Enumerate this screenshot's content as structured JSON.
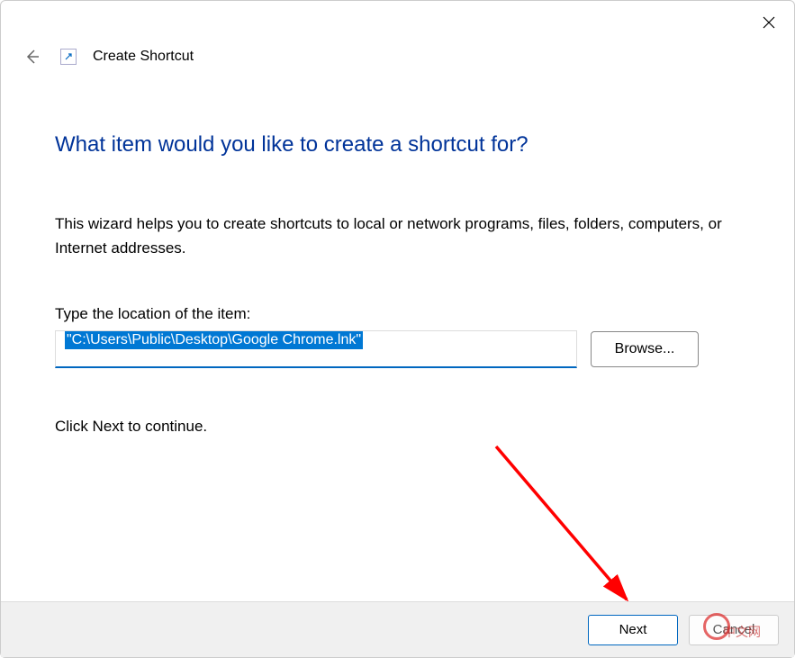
{
  "window": {
    "title": "Create Shortcut"
  },
  "wizard": {
    "heading": "What item would you like to create a shortcut for?",
    "description": "This wizard helps you to create shortcuts to local or network programs, files, folders, computers, or Internet addresses.",
    "location_label": "Type the location of the item:",
    "location_value": "\"C:\\Users\\Public\\Desktop\\Google Chrome.lnk\"",
    "browse_label": "Browse...",
    "continue_text": "Click Next to continue."
  },
  "footer": {
    "next_label": "Next",
    "cancel_label": "Cancel"
  },
  "watermark": {
    "text": "中文网"
  }
}
